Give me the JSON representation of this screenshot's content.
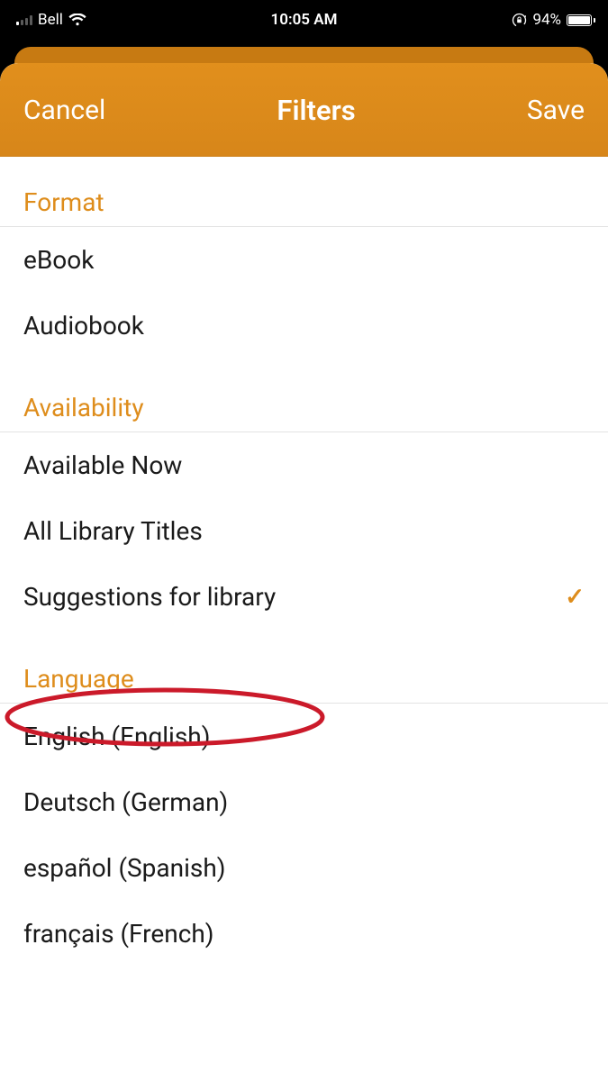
{
  "statusBar": {
    "carrier": "Bell",
    "time": "10:05 AM",
    "batteryPercent": "94%"
  },
  "nav": {
    "cancel": "Cancel",
    "title": "Filters",
    "save": "Save"
  },
  "sections": {
    "format": {
      "header": "Format",
      "items": [
        "eBook",
        "Audiobook"
      ]
    },
    "availability": {
      "header": "Availability",
      "items": [
        "Available Now",
        "All Library Titles",
        "Suggestions for library"
      ],
      "selectedIndex": 2
    },
    "language": {
      "header": "Language",
      "items": [
        "English (English)",
        "Deutsch (German)",
        "español (Spanish)",
        "français (French)"
      ]
    }
  },
  "colors": {
    "accent": "#de8d1c",
    "navBg": "#d9891a",
    "annotation": "#cb1a2a"
  }
}
